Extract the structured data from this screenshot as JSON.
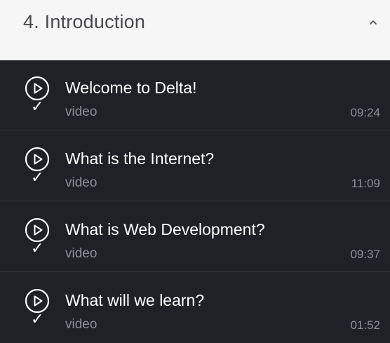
{
  "section": {
    "title": "4. Introduction",
    "toggle_icon": "chevron-up-icon"
  },
  "lectures": [
    {
      "title": "Welcome to Delta!",
      "type": "video",
      "duration": "09:24",
      "completed": true,
      "check": "✓"
    },
    {
      "title": "What is the Internet?",
      "type": "video",
      "duration": "11:09",
      "completed": true,
      "check": "✓"
    },
    {
      "title": "What is Web Development?",
      "type": "video",
      "duration": "09:37",
      "completed": true,
      "check": "✓"
    },
    {
      "title": "What will we learn?",
      "type": "video",
      "duration": "01:52",
      "completed": true,
      "check": "✓"
    }
  ],
  "colors": {
    "header_bg": "#f6f6f7",
    "list_bg": "#1f2126",
    "text_primary": "#ffffff",
    "text_muted": "#8e9097"
  }
}
